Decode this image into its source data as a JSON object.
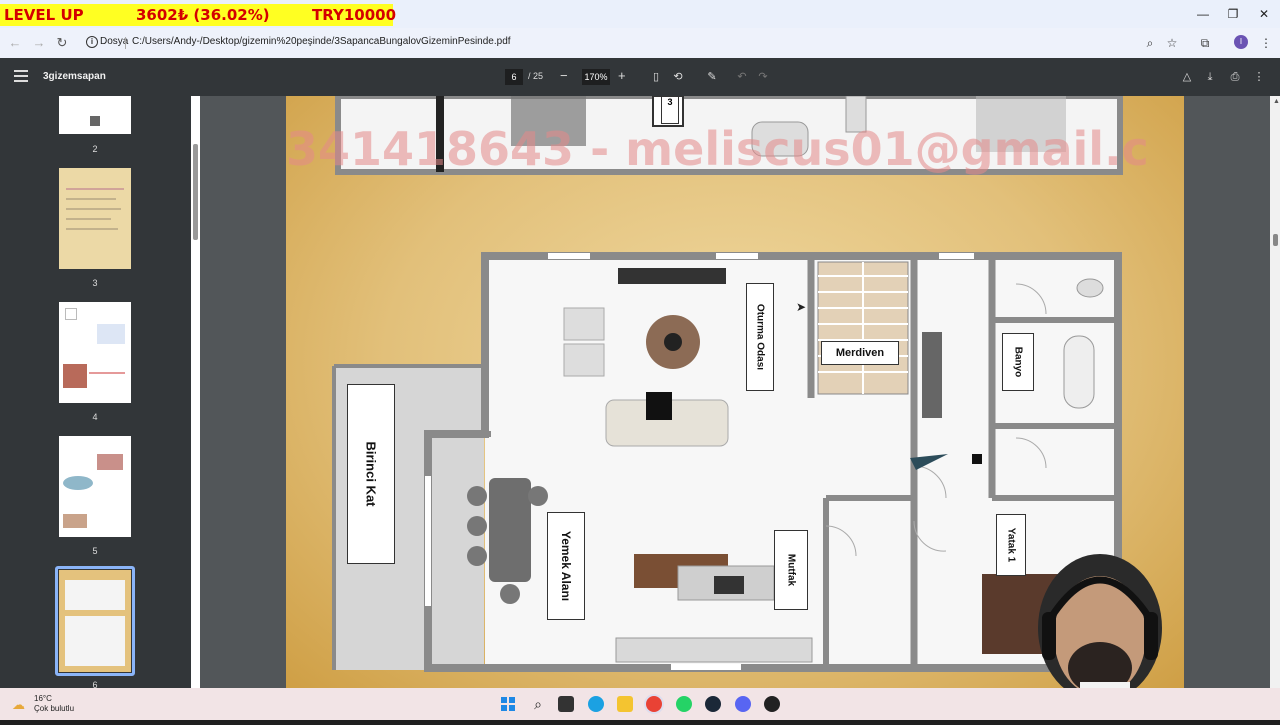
{
  "ticker": {
    "item1": "LEVEL UP",
    "item2": "3602₺ (36.02%)",
    "item3": "TRY10000"
  },
  "browser": {
    "protocol_label": "Dosya",
    "url": "C:/Users/Andy-/Desktop/gizemin%20peşinde/3SapancaBungalovGizeminPesinde.pdf"
  },
  "pdf_toolbar": {
    "title": "3gizemsapan",
    "current_page": "6",
    "total_pages": "/ 25",
    "zoom": "170%"
  },
  "thumbnails": [
    {
      "label": "2"
    },
    {
      "label": "3"
    },
    {
      "label": "4"
    },
    {
      "label": "5"
    },
    {
      "label": "6"
    }
  ],
  "floorplan": {
    "watermark": "341418643 - meliscus01@gmail.c",
    "rooms": {
      "stairs": "Merdiven",
      "living": "Oturma Odası",
      "bath": "Banyo",
      "floor": "Birinci Kat",
      "dining": "Yemek Alanı",
      "kitchen": "Mutfak",
      "bedroom": "Yatak 1",
      "top_partial": "3"
    }
  },
  "taskbar": {
    "temperature": "16°C",
    "weather": "Çok bulutlu"
  },
  "colors": {
    "pdf_toolbar_bg": "#323639",
    "viewer_bg": "#525659",
    "ticker_bg": "#ffff22",
    "ticker_text": "#d40000",
    "thumb_selected_border": "#8ab4f8"
  }
}
